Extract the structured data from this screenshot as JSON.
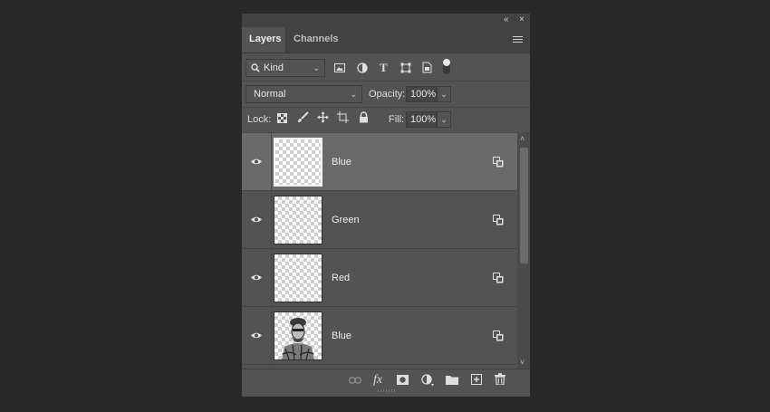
{
  "panel": {
    "window_controls": {
      "collapse": "«",
      "close": "×"
    },
    "tabs": [
      {
        "label": "Layers",
        "active": true
      },
      {
        "label": "Channels",
        "active": false
      }
    ],
    "filter": {
      "kind_label": "Kind",
      "toggle_on": true
    },
    "blend_mode": "Normal",
    "opacity": {
      "label": "Opacity:",
      "value": "100%"
    },
    "lock": {
      "label": "Lock:"
    },
    "fill": {
      "label": "Fill:",
      "value": "100%"
    },
    "layers": [
      {
        "name": "Blue",
        "selected": true,
        "visible": true,
        "thumb": "transparent"
      },
      {
        "name": "Green",
        "selected": false,
        "visible": true,
        "thumb": "transparent"
      },
      {
        "name": "Red",
        "selected": false,
        "visible": true,
        "thumb": "transparent"
      },
      {
        "name": "Blue",
        "selected": false,
        "visible": true,
        "thumb": "photo"
      }
    ],
    "bottom_icons": [
      "link-icon",
      "fx-icon",
      "mask-icon",
      "adjustment-icon",
      "folder-icon",
      "new-layer-icon",
      "trash-icon"
    ],
    "colors": {
      "panel_bg": "#535353",
      "selected_row": "#6a6a6a",
      "app_bg": "#282828"
    }
  }
}
